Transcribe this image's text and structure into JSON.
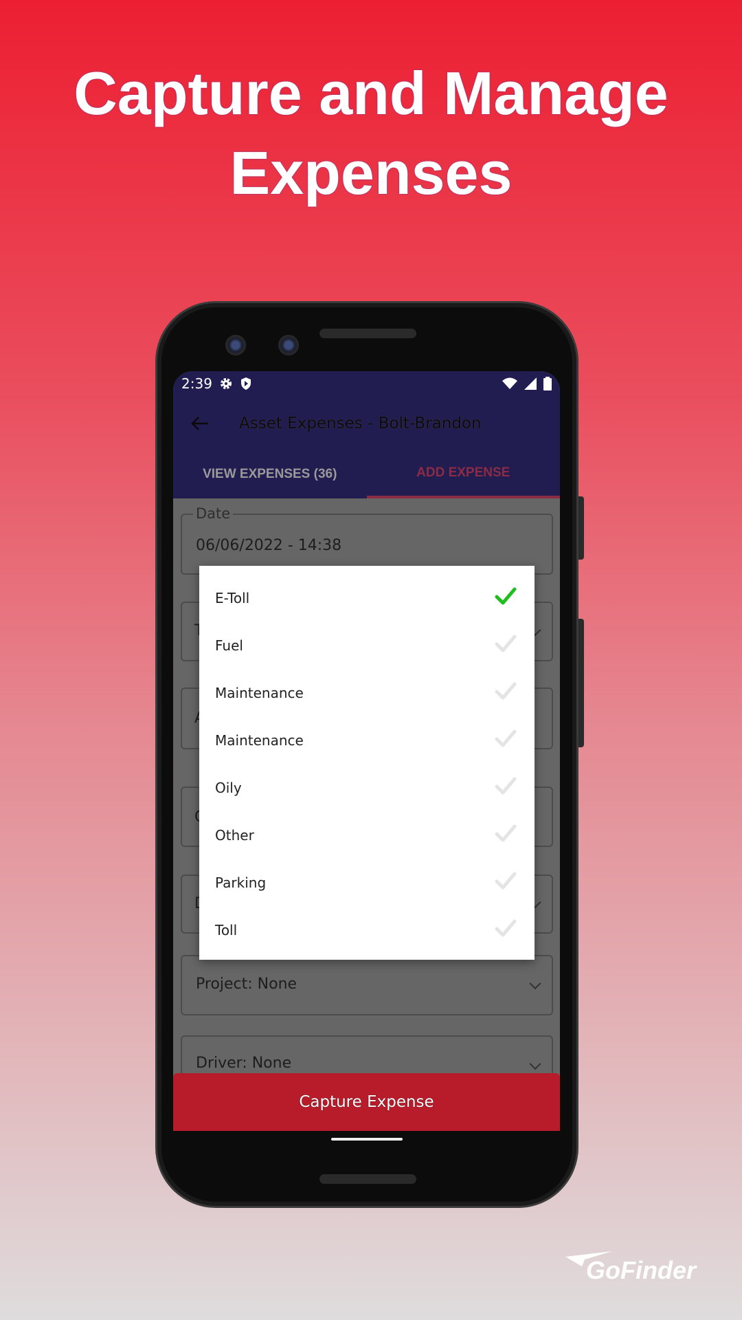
{
  "headline": {
    "line1": "Capture and Manage",
    "line2": "Expenses"
  },
  "status_bar": {
    "time": "2:39",
    "icons": [
      "gear-icon",
      "shield-play-icon",
      "wifi-icon",
      "signal-icon",
      "battery-icon"
    ]
  },
  "app_bar": {
    "title": "Asset Expenses - Bolt-Brandon",
    "back_icon": "arrow-left-icon"
  },
  "tabs": [
    {
      "label": "VIEW EXPENSES (36)",
      "active": false
    },
    {
      "label": "ADD EXPENSE",
      "active": true
    }
  ],
  "form": {
    "date": {
      "label": "Date",
      "value": "06/06/2022 - 14:38"
    },
    "hidden_fields": [
      "T",
      "A",
      "C",
      "D"
    ],
    "project": {
      "value": "Project: None"
    },
    "driver": {
      "value": "Driver: None"
    },
    "capture_button": "Capture Expense"
  },
  "dialog": {
    "options": [
      {
        "label": "E-Toll",
        "selected": true
      },
      {
        "label": "Fuel",
        "selected": false
      },
      {
        "label": "Maintenance",
        "selected": false
      },
      {
        "label": "Maintenance",
        "selected": false
      },
      {
        "label": "Oily",
        "selected": false
      },
      {
        "label": "Other",
        "selected": false
      },
      {
        "label": "Parking",
        "selected": false
      },
      {
        "label": "Toll",
        "selected": false
      }
    ]
  },
  "logo": "GoFinder",
  "colors": {
    "accent": "#b81c2a",
    "appbar": "#221d50",
    "check_selected": "#1fbf1f",
    "check_unselected": "#e4e4e4"
  }
}
